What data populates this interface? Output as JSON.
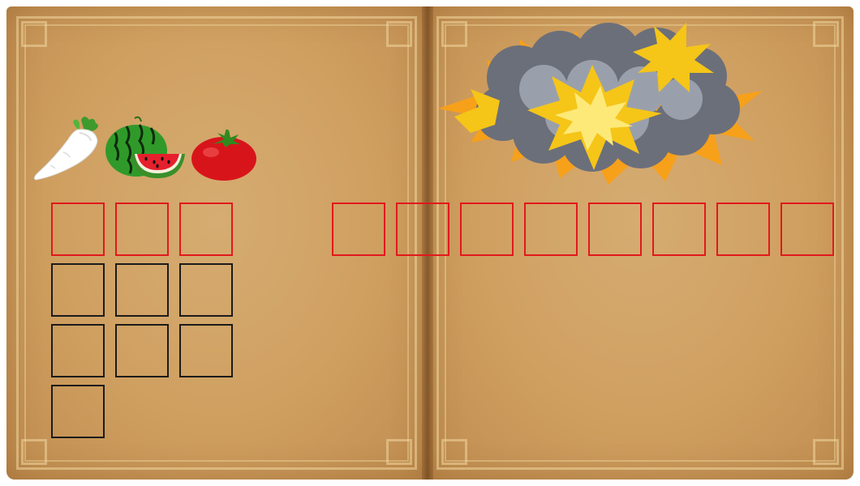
{
  "scene": {
    "items": [
      {
        "name": "daikon-radish",
        "icon": "daikon-radish-icon"
      },
      {
        "name": "watermelon",
        "icon": "watermelon-icon"
      },
      {
        "name": "tomato",
        "icon": "tomato-icon"
      }
    ],
    "effect": {
      "icon": "explosion-icon"
    }
  },
  "slots": {
    "left_answer_count": 3,
    "right_answer_count": 8,
    "choice_count": 7
  },
  "colors": {
    "page": "#cf9f60",
    "answer_slot_border": "#e1191c",
    "choice_slot_border": "#1b1b1b"
  }
}
